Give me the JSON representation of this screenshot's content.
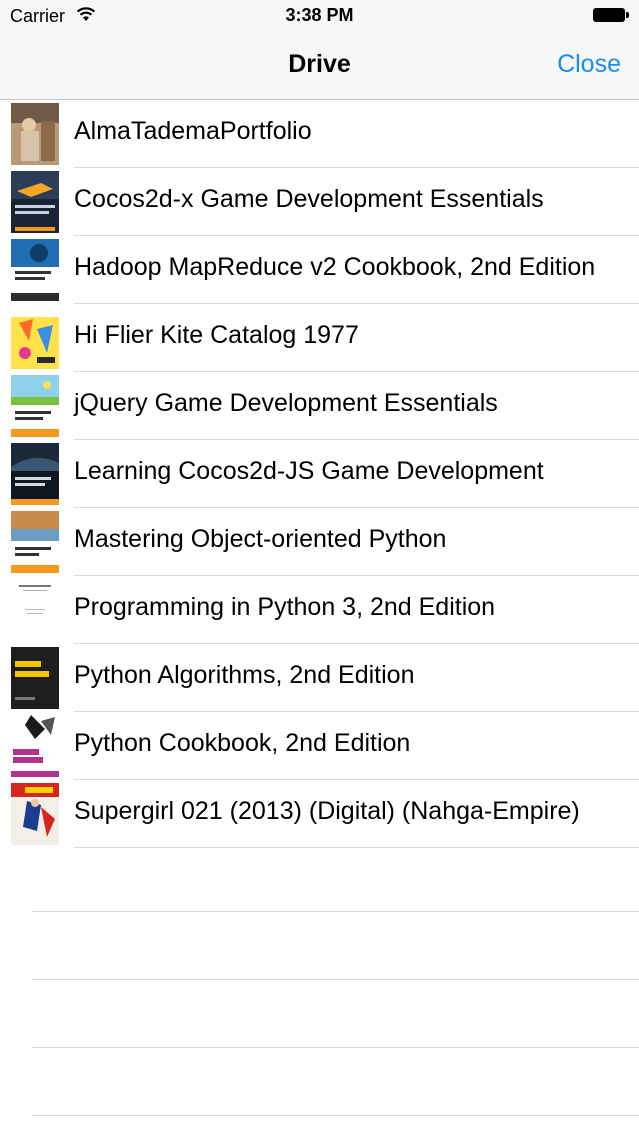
{
  "status": {
    "carrier": "Carrier",
    "time": "3:38 PM"
  },
  "nav": {
    "title": "Drive",
    "close_label": "Close"
  },
  "items": [
    {
      "label": "AlmaTademaPortfolio",
      "thumb": "alma"
    },
    {
      "label": "Cocos2d-x Game Development Essentials",
      "thumb": "cocos2dx"
    },
    {
      "label": "Hadoop MapReduce v2 Cookbook, 2nd Edition",
      "thumb": "hadoop"
    },
    {
      "label": "Hi Flier Kite Catalog 1977",
      "thumb": "kite"
    },
    {
      "label": "jQuery Game Development Essentials",
      "thumb": "jquery"
    },
    {
      "label": "Learning Cocos2d-JS Game Development",
      "thumb": "cocosjs"
    },
    {
      "label": "Mastering Object-oriented Python",
      "thumb": "mastering"
    },
    {
      "label": "Programming in Python 3, 2nd Edition",
      "thumb": "programming"
    },
    {
      "label": "Python Algorithms, 2nd Edition",
      "thumb": "algorithms"
    },
    {
      "label": "Python Cookbook, 2nd Edition",
      "thumb": "cookbook"
    },
    {
      "label": "Supergirl 021 (2013) (Digital) (Nahga-Empire)",
      "thumb": "supergirl"
    }
  ],
  "colors": {
    "accent": "#1a8cf0",
    "separator": "#d9d9dc",
    "navbar": "#f7f7f8"
  }
}
